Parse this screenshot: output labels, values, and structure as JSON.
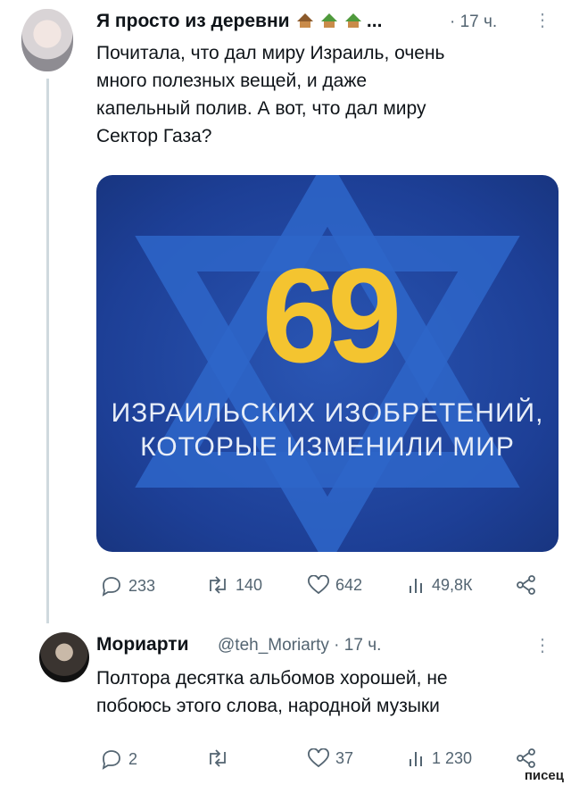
{
  "tweet1": {
    "author": "Я просто из деревни",
    "ellipsis": "...",
    "time": "· 17 ч.",
    "more": "⋮",
    "lines": [
      "Почитала, что дал миру Израиль, очень",
      "много полезных вещей, и даже",
      "капельный полив. А вот, что дал миру",
      "Сектор Газа?"
    ],
    "card": {
      "number": "69",
      "line1": "ИЗРАИЛЬСКИХ ИЗОБРЕТЕНИЙ,",
      "line2": "КОТОРЫЕ ИЗМЕНИЛИ МИР"
    },
    "stats": {
      "replies": "233",
      "retweets": "140",
      "likes": "642",
      "views": "49,8К"
    }
  },
  "tweet2": {
    "author": "Мориарти",
    "handle": "@teh_Moriarty",
    "time": "· 17 ч.",
    "more": "⋮",
    "lines": [
      "Полтора десятка альбомов хорошей, не",
      "побоюсь этого слова, народной музыки"
    ],
    "stats": {
      "replies": "2",
      "retweets": "",
      "likes": "37",
      "views": "1 230"
    }
  },
  "watermark": "писец",
  "colors": {
    "card_blue": "#1d3f96",
    "gold": "#f4c430",
    "meta_gray": "#536471"
  }
}
